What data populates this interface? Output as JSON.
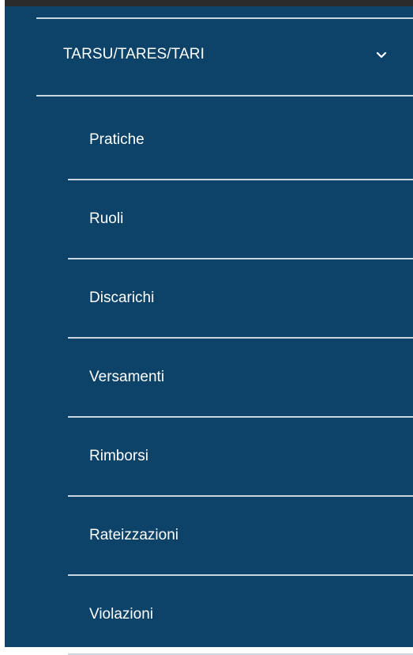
{
  "colors": {
    "sidebar_bg": "#0e4369",
    "divider": "#c9d6e2",
    "text": "#ffffff"
  },
  "menu": {
    "parent": {
      "label": "TARSU/TARES/TARI",
      "icon": "chevron-down-icon",
      "expanded": true
    },
    "items": [
      {
        "label": "Pratiche"
      },
      {
        "label": "Ruoli"
      },
      {
        "label": "Discarichi"
      },
      {
        "label": "Versamenti"
      },
      {
        "label": "Rimborsi"
      },
      {
        "label": "Rateizzazioni"
      },
      {
        "label": "Violazioni"
      }
    ]
  }
}
